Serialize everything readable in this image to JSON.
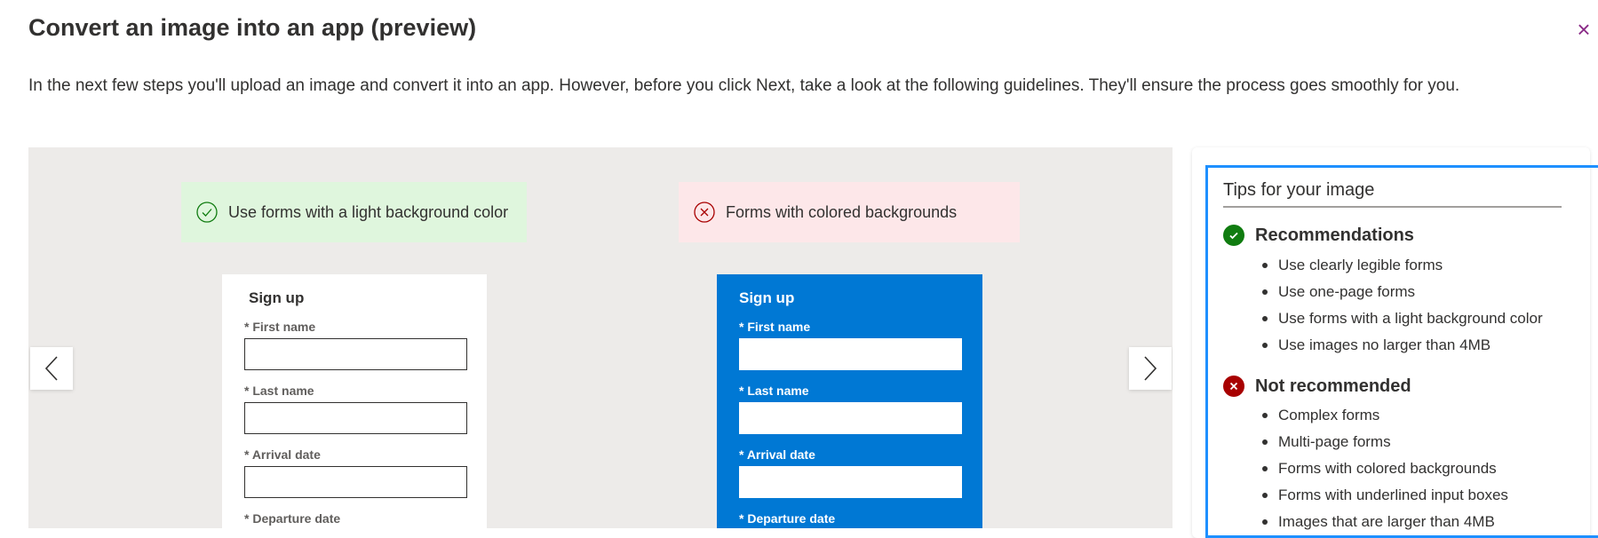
{
  "dialog": {
    "title": "Convert an image into an app (preview)",
    "close_label": "×",
    "intro": "In the next few steps you'll upload an image and convert it into an app. However, before you click Next, take a look at the following guidelines. They'll ensure the process goes smoothly for you."
  },
  "carousel": {
    "good": {
      "banner": "Use forms with a light background color",
      "form_title": "Sign up",
      "fields": [
        "* First name",
        "* Last name",
        "* Arrival date",
        "* Departure date"
      ]
    },
    "bad": {
      "banner": "Forms with colored backgrounds",
      "form_title": "Sign up",
      "fields": [
        "* First name",
        "* Last name",
        "* Arrival date",
        "* Departure date"
      ]
    }
  },
  "tips": {
    "title": "Tips for your image",
    "recommendations": {
      "heading": "Recommendations",
      "items": [
        "Use clearly legible forms",
        "Use one-page forms",
        "Use forms with a light background color",
        "Use images no larger than 4MB"
      ]
    },
    "not_recommended": {
      "heading": "Not recommended",
      "items": [
        "Complex forms",
        "Multi-page forms",
        "Forms with colored backgrounds",
        "Forms with underlined input boxes",
        "Images that are larger than 4MB"
      ]
    }
  },
  "colors": {
    "accent": "#0078d4",
    "success": "#107c10",
    "error": "#a80000",
    "close": "#8a2b87"
  }
}
